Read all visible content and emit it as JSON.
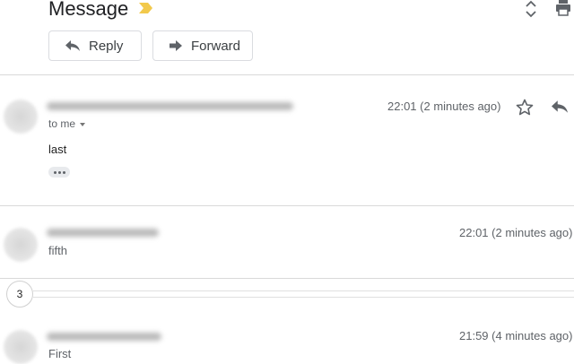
{
  "header": {
    "subject": "Message",
    "icons": [
      "important-marker-icon",
      "expand-collapse-icon",
      "print-icon"
    ]
  },
  "actions": {
    "reply_label": "Reply",
    "forward_label": "Forward"
  },
  "messages": [
    {
      "recipient": "to me",
      "time": "22:01 (2 minutes ago)",
      "body": "last",
      "expanded": true
    },
    {
      "time": "22:01 (2 minutes ago)",
      "snippet": "fifth",
      "expanded": false
    },
    {
      "time": "21:59 (4 minutes ago)",
      "snippet": "First",
      "expanded": false
    }
  ],
  "collapsed": {
    "count": "3"
  },
  "colors": {
    "important_marker": "#f2c94c",
    "border": "#dadce0",
    "muted_text": "#5f6368"
  }
}
